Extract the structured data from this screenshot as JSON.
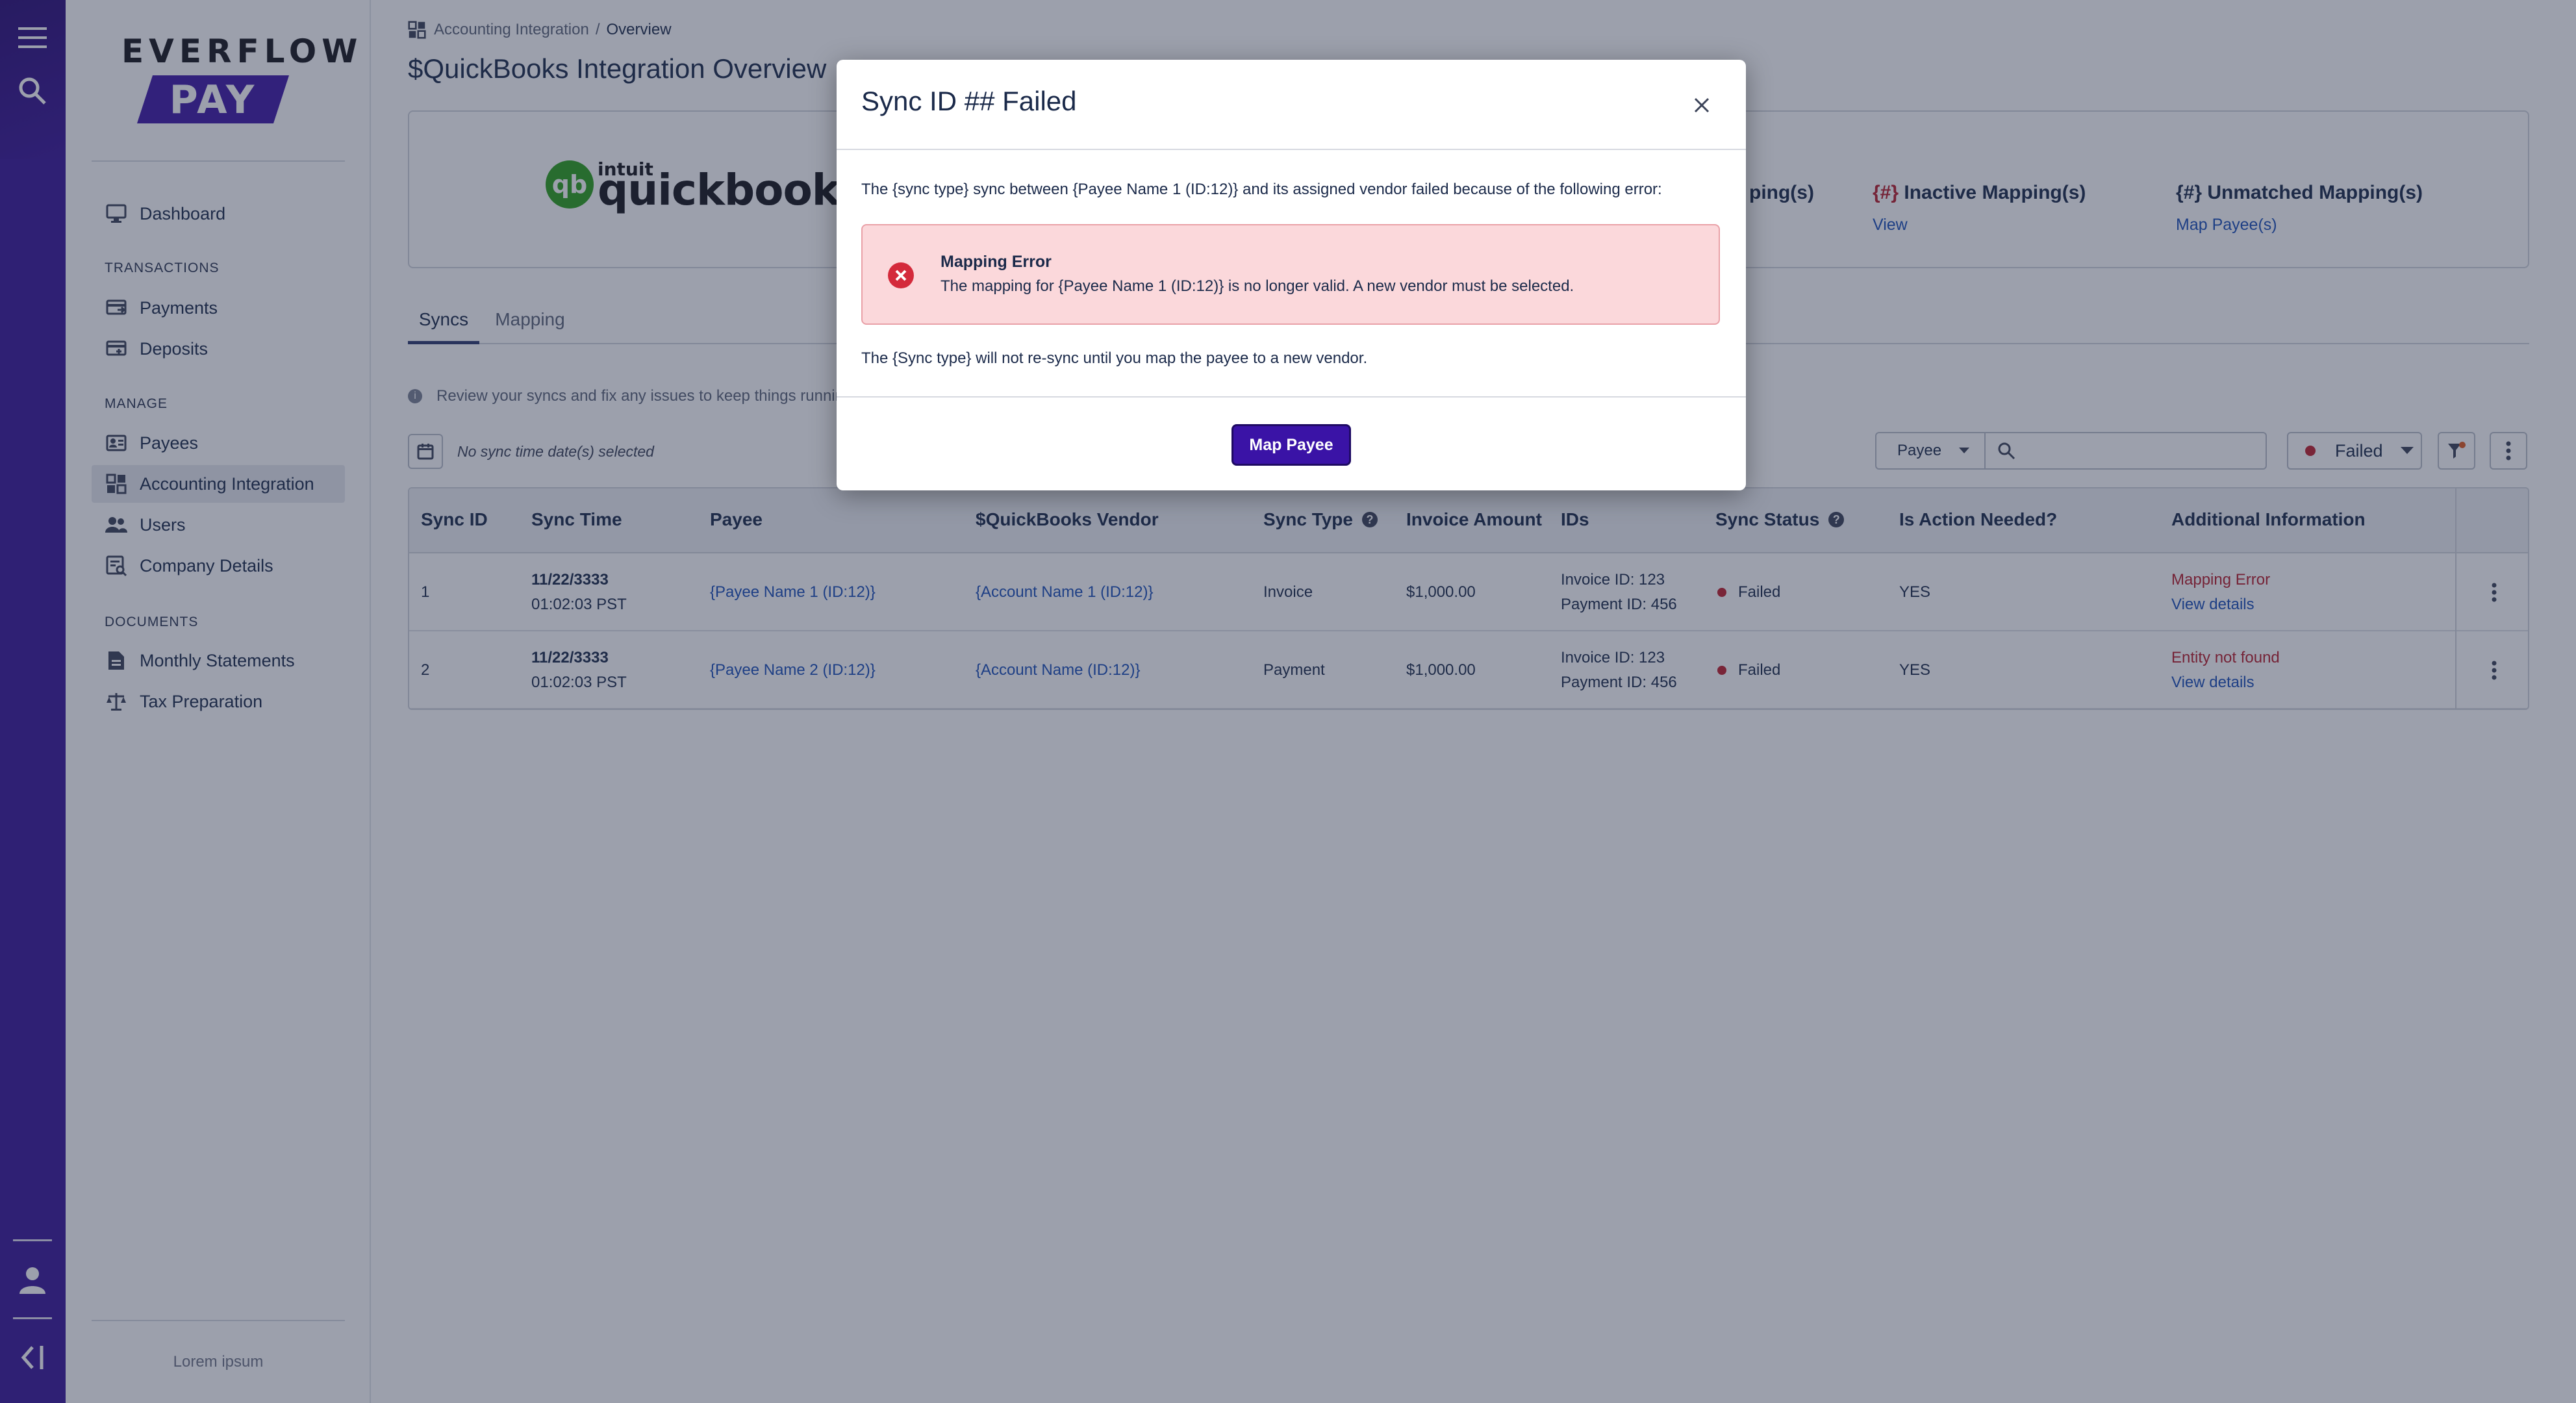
{
  "brand": {
    "name_top": "EVERFLOW",
    "name_bottom": "PAY"
  },
  "sidebar": {
    "items": [
      {
        "label": "Dashboard",
        "icon": "monitor-icon"
      },
      {
        "label": "Payments",
        "icon": "payments-icon"
      },
      {
        "label": "Deposits",
        "icon": "deposits-icon"
      },
      {
        "label": "Payees",
        "icon": "payees-icon"
      },
      {
        "label": "Accounting Integration",
        "icon": "accounting-icon",
        "active": true
      },
      {
        "label": "Users",
        "icon": "users-icon"
      },
      {
        "label": "Company Details",
        "icon": "company-icon"
      },
      {
        "label": "Monthly Statements",
        "icon": "statement-icon"
      },
      {
        "label": "Tax Preparation",
        "icon": "scale-icon"
      }
    ],
    "sections": {
      "transactions": "TRANSACTIONS",
      "manage": "MANAGE",
      "documents": "DOCUMENTS"
    },
    "footer": "Lorem ipsum"
  },
  "breadcrumb": {
    "parent": "Accounting Integration",
    "separator": "/",
    "current": "Overview"
  },
  "page_title": "$QuickBooks Integration Overview",
  "integration": {
    "logo_small": "intuit",
    "logo_main": "quickbooks.",
    "logo_mark": "qb",
    "metrics": [
      {
        "title_partial": "ping(s)"
      },
      {
        "num": "{#}",
        "title": " Inactive Mapping(s)",
        "link": "View"
      },
      {
        "num": "{#}",
        "title": " Unmatched Mapping(s)",
        "link": "Map Payee(s)"
      }
    ]
  },
  "tabs": [
    {
      "label": "Syncs",
      "active": true
    },
    {
      "label": "Mapping",
      "active": false
    }
  ],
  "info_text": "Review your syncs and fix any issues to keep things running",
  "filters": {
    "date_text": "No sync time date(s) selected",
    "payee_select": "Payee",
    "search_value": "",
    "status_select": "Failed"
  },
  "table": {
    "headers": [
      "Sync ID",
      "Sync Time",
      "Payee",
      "$QuickBooks Vendor",
      "Sync Type",
      "Invoice Amount",
      "IDs",
      "Sync Status",
      "Is Action Needed?",
      "Additional Information"
    ],
    "rows": [
      {
        "id": "1",
        "date": "11/22/3333",
        "time": "01:02:03 PST",
        "payee": "{Payee Name 1 (ID:12)}",
        "vendor": "{Account Name 1 (ID:12)}",
        "type": "Invoice",
        "amount": "$1,000.00",
        "invoice_id": "Invoice ID: 123",
        "payment_id": "Payment ID: 456",
        "status": "Failed",
        "action": "YES",
        "info": "Mapping Error",
        "details": "View details"
      },
      {
        "id": "2",
        "date": "11/22/3333",
        "time": "01:02:03 PST",
        "payee": "{Payee Name 2 (ID:12)}",
        "vendor": "{Account Name (ID:12)}",
        "type": "Payment",
        "amount": "$1,000.00",
        "invoice_id": "Invoice ID: 123",
        "payment_id": "Payment ID: 456",
        "status": "Failed",
        "action": "YES",
        "info": "Entity not found",
        "details": "View details"
      }
    ]
  },
  "modal": {
    "title": "Sync ID ## Failed",
    "intro": "The {sync type} sync between {Payee Name 1 (ID:12)} and its assigned vendor failed because of the following error:",
    "alert_title": "Mapping Error",
    "alert_message": "The mapping for {Payee Name 1 (ID:12)} is no longer valid. A new vendor must be selected.",
    "note": "The {Sync type} will not re-sync until you map the payee to a new vendor.",
    "button": "Map Payee"
  },
  "colors": {
    "brand": "#3a1699",
    "error": "#b81d2a",
    "link": "#1a4fb8",
    "primary_button": "#3a13a6"
  }
}
